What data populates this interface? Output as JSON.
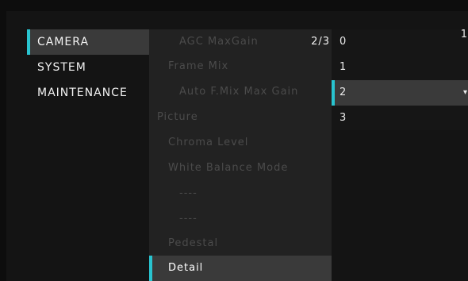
{
  "left_menu": {
    "items": [
      {
        "label": "CAMERA"
      },
      {
        "label": "SYSTEM"
      },
      {
        "label": "MAINTENANCE"
      }
    ]
  },
  "middle_menu": {
    "page_indicator": "2/3",
    "items": [
      {
        "label": "AGC MaxGain"
      },
      {
        "label": "Frame Mix"
      },
      {
        "label": "Auto F.Mix Max Gain"
      },
      {
        "label": "Picture"
      },
      {
        "label": "Chroma Level"
      },
      {
        "label": "White Balance Mode"
      },
      {
        "label": "----"
      },
      {
        "label": "----"
      },
      {
        "label": "Pedestal"
      },
      {
        "label": "Detail"
      }
    ]
  },
  "value_menu": {
    "corner_mark": "1",
    "options": [
      {
        "label": "0"
      },
      {
        "label": "1"
      },
      {
        "label": "2"
      },
      {
        "label": "3"
      }
    ],
    "selected_index": 2
  },
  "colors": {
    "accent": "#29c4d0",
    "selected_bg": "#3a3a3a",
    "dimmed_text": "#4b4b4b"
  }
}
